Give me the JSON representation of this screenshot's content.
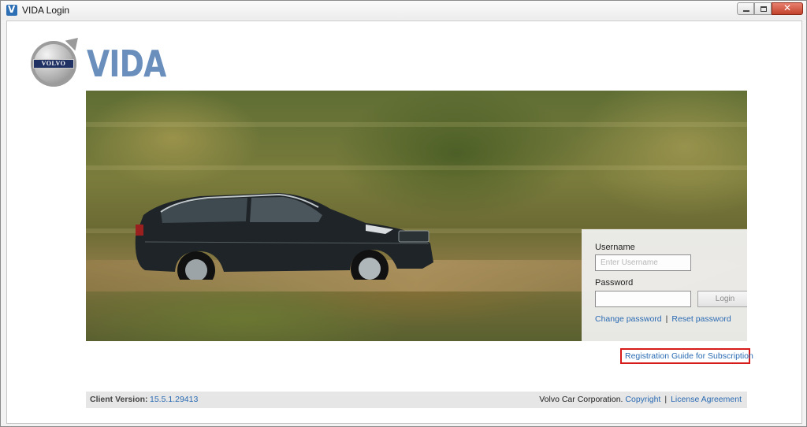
{
  "window": {
    "title": "VIDA Login",
    "close_glyph": "✕"
  },
  "logo": {
    "brand_badge": "VOLVO",
    "wordmark": "VIDA"
  },
  "login": {
    "username_label": "Username",
    "username_placeholder": "Enter Username",
    "username_value": "",
    "password_label": "Password",
    "password_value": "",
    "login_button": "Login",
    "change_password": "Change password",
    "separator": "|",
    "reset_password": "Reset password"
  },
  "registration": {
    "link": "Registration Guide for Subscription",
    "highlight_color": "#d71a1a"
  },
  "footer": {
    "client_version_label": "Client Version:",
    "client_version_value": "15.5.1.29413",
    "company": "Volvo Car Corporation.",
    "copyright": "Copyright",
    "separator": "|",
    "license": "License Agreement"
  },
  "colors": {
    "link": "#2a6bb3",
    "logo_word": "#6a8fbd"
  },
  "icons": {
    "app": "vida-app-icon",
    "minimize": "minimize-icon",
    "maximize": "maximize-icon",
    "close": "close-icon",
    "brand": "volvo-logo-icon"
  }
}
